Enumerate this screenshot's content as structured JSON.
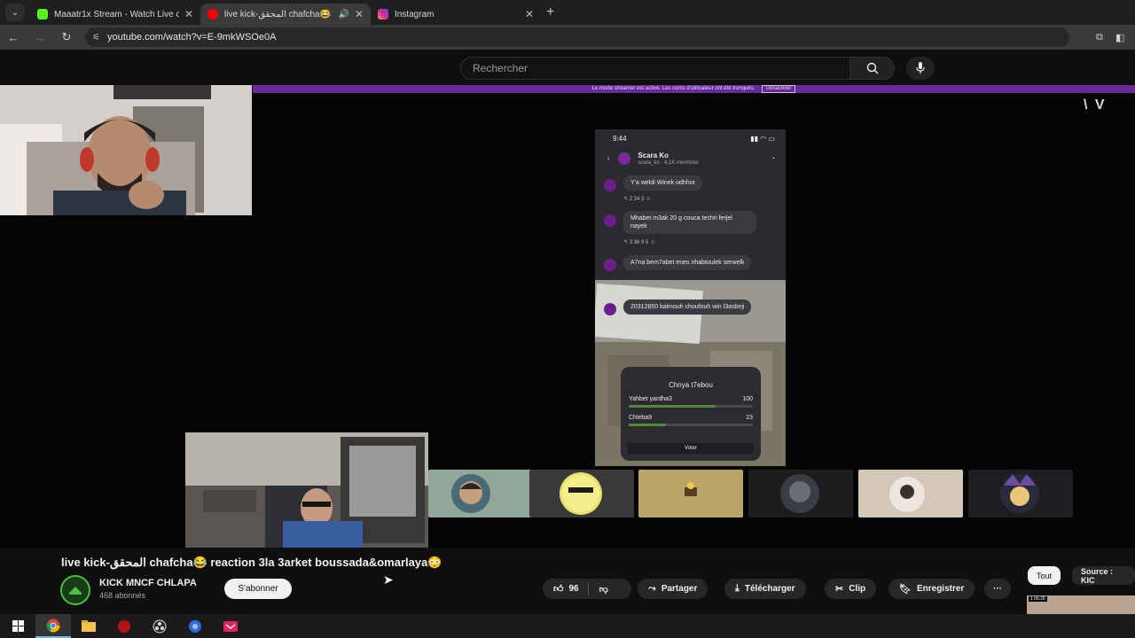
{
  "browser": {
    "tabs": [
      {
        "title": "Maaatr1x Stream - Watch Live o",
        "icon": "kick-icon",
        "color": "#53fc18"
      },
      {
        "title": "live kick-المحقق chafcha😂",
        "icon": "youtube-icon",
        "color": "#ff0000",
        "active": true
      },
      {
        "title": "Instagram",
        "icon": "instagram-icon",
        "color": "#d6249f"
      }
    ],
    "url": "youtube.com/watch?v=E-9mkWSOe0A"
  },
  "youtube": {
    "search_placeholder": "Rechercher",
    "streamer_banner": "Le mode streamer est activé. Les noms d'utilisateur ont été tronqués.",
    "banner_button": "Désactiver",
    "watermark": "\\ V"
  },
  "phone": {
    "time": "9:44",
    "channel": "Scara Ko",
    "channel_sub": "scara_ko · 4,1K membres",
    "messages": [
      {
        "text": "Y'a weldi Winek odhhor",
        "actions": "↰ 2    34    3    ☺"
      },
      {
        "text": "Mhabet m3ak 20 g couca techri ferjel nayek",
        "actions": "↰ 3    36    9    5    ☺"
      },
      {
        "text": "A7na bem7abet enes nhabtoulek serwelk",
        "actions": ""
      },
      {
        "text": "20312850 kalmouh choufouh win l3asbeji",
        "actions": ""
      }
    ],
    "poll_question": "Chnya t7ebou",
    "poll_options": [
      {
        "label": "Yahbet yardha3",
        "count": "100",
        "fill": 0.7
      },
      {
        "label": "Chleba9",
        "count": "23",
        "fill": 0.3
      }
    ],
    "vote_label": "Voter"
  },
  "video_info": {
    "title": "live kick-المحقق chafcha😂 reaction 3la 3arket boussada&omarlaya😳",
    "channel_name": "KICK MNCF CHLAPA",
    "subscribers": "468 abonnés",
    "subscribe_label": "S'abonner",
    "likes": "96",
    "share_label": "Partager",
    "download_label": "Télécharger",
    "clip_label": "Clip",
    "save_label": "Enregistrer",
    "more_label": "···"
  },
  "chips": {
    "all": "Tout",
    "source": "Source : KIC"
  },
  "thumb_badge": "1:06:28"
}
